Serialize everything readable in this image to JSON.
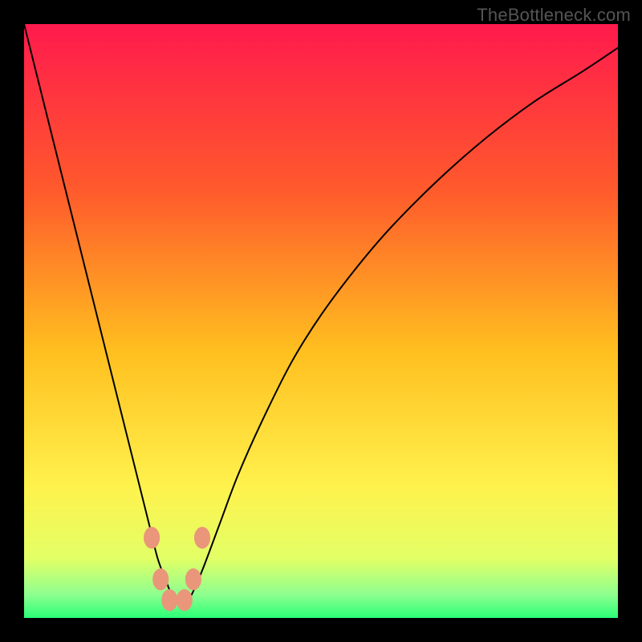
{
  "watermark": "TheBottleneck.com",
  "chart_data": {
    "type": "line",
    "title": "",
    "xlabel": "",
    "ylabel": "",
    "xlim": [
      0,
      100
    ],
    "ylim": [
      0,
      100
    ],
    "grid": false,
    "background_gradient": {
      "stops": [
        {
          "pos": 0,
          "color": "#ff1a4d"
        },
        {
          "pos": 28,
          "color": "#ff5a2c"
        },
        {
          "pos": 55,
          "color": "#ffbf1f"
        },
        {
          "pos": 78,
          "color": "#fff24d"
        },
        {
          "pos": 90,
          "color": "#e2ff66"
        },
        {
          "pos": 96,
          "color": "#8fff8f"
        },
        {
          "pos": 100,
          "color": "#2bff77"
        }
      ]
    },
    "series": [
      {
        "name": "bottleneck-curve",
        "color": "#000000",
        "width": 2,
        "x": [
          0,
          3,
          6,
          9,
          12,
          15,
          18,
          19.5,
          21,
          22.5,
          24,
          25,
          26,
          27,
          28,
          30,
          33,
          36,
          40,
          45,
          50,
          56,
          62,
          70,
          78,
          86,
          94,
          100
        ],
        "y": [
          100,
          88,
          76,
          64,
          52,
          40,
          28,
          22,
          16,
          10,
          6,
          3.5,
          2.5,
          2.5,
          3.5,
          8,
          16,
          24,
          33,
          43,
          51,
          59,
          66,
          74,
          81,
          87,
          92,
          96
        ]
      }
    ],
    "markers": [
      {
        "x": 21.5,
        "y": 13.5,
        "r": 1.6,
        "color": "#e9967a"
      },
      {
        "x": 23.0,
        "y": 6.5,
        "r": 1.6,
        "color": "#e9967a"
      },
      {
        "x": 24.5,
        "y": 3.0,
        "r": 1.6,
        "color": "#e9967a"
      },
      {
        "x": 27.0,
        "y": 3.0,
        "r": 1.6,
        "color": "#e9967a"
      },
      {
        "x": 28.5,
        "y": 6.5,
        "r": 1.6,
        "color": "#e9967a"
      },
      {
        "x": 30.0,
        "y": 13.5,
        "r": 1.6,
        "color": "#e9967a"
      }
    ]
  }
}
